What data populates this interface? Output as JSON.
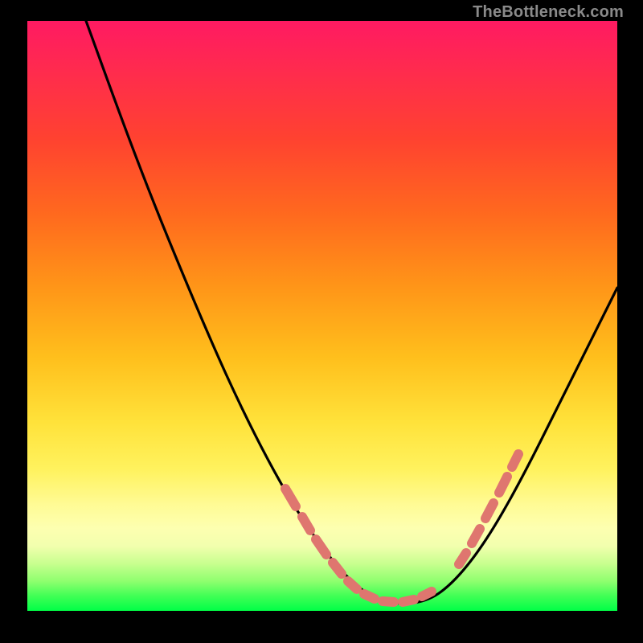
{
  "watermark": {
    "text": "TheBottleneck.com"
  },
  "chart_data": {
    "type": "line",
    "title": "",
    "xlabel": "",
    "ylabel": "",
    "xlim": [
      0,
      100
    ],
    "ylim": [
      0,
      100
    ],
    "grid": false,
    "legend": false,
    "series": [
      {
        "name": "main-curve",
        "color": "#000000",
        "x": [
          10,
          15,
          20,
          25,
          30,
          35,
          40,
          45,
          50,
          55,
          57,
          60,
          63,
          65,
          68,
          70,
          75,
          80,
          85,
          90,
          100
        ],
        "y": [
          100,
          91,
          81,
          72,
          62,
          52,
          42,
          33,
          23,
          12,
          9,
          5,
          3,
          2,
          2,
          3,
          8,
          17,
          27,
          37,
          59
        ]
      },
      {
        "name": "highlight-left",
        "color": "#e46a6a",
        "style": "dashed-thick",
        "x": [
          45,
          47,
          49,
          51,
          53,
          55,
          57,
          58.5,
          60,
          61.5,
          63
        ],
        "y": [
          33,
          29,
          25,
          21,
          17,
          13,
          9,
          7,
          5,
          4,
          3
        ]
      },
      {
        "name": "highlight-bottom",
        "color": "#e46a6a",
        "style": "dashed-thick",
        "x": [
          58,
          60,
          62,
          64,
          66,
          68,
          70
        ],
        "y": [
          6,
          4.5,
          3,
          2.2,
          2,
          2.2,
          3
        ]
      },
      {
        "name": "highlight-right",
        "color": "#e46a6a",
        "style": "dashed-thick",
        "x": [
          74,
          75.5,
          77,
          78.5,
          80,
          81.5,
          83
        ],
        "y": [
          7,
          10,
          13,
          16.5,
          20,
          23.5,
          27
        ]
      }
    ]
  }
}
